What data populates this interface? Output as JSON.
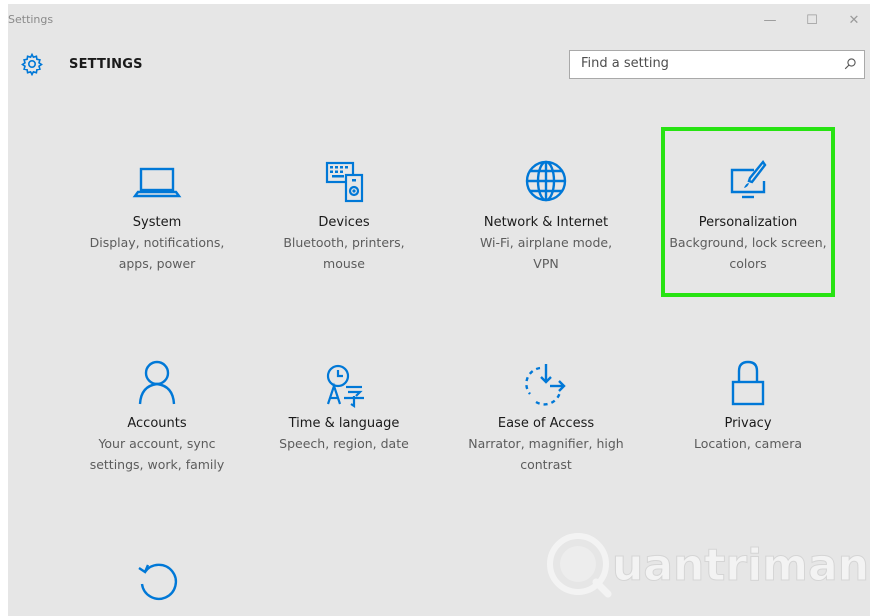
{
  "window": {
    "title": "Settings",
    "controls": {
      "minimize": "—",
      "maximize": "☐",
      "close": "✕"
    }
  },
  "header": {
    "title": "SETTINGS",
    "search_placeholder": "Find a setting"
  },
  "tiles": [
    {
      "label": "System",
      "desc": "Display, notifications, apps, power",
      "icon": "laptop-icon"
    },
    {
      "label": "Devices",
      "desc": "Bluetooth, printers, mouse",
      "icon": "devices-icon"
    },
    {
      "label": "Network & Internet",
      "desc": "Wi-Fi, airplane mode, VPN",
      "icon": "globe-icon"
    },
    {
      "label": "Personalization",
      "desc": "Background, lock screen, colors",
      "icon": "personalization-icon"
    },
    {
      "label": "Accounts",
      "desc": "Your account, sync settings, work, family",
      "icon": "person-icon"
    },
    {
      "label": "Time & language",
      "desc": "Speech, region, date",
      "icon": "time-language-icon"
    },
    {
      "label": "Ease of Access",
      "desc": "Narrator, magnifier, high contrast",
      "icon": "ease-of-access-icon"
    },
    {
      "label": "Privacy",
      "desc": "Location, camera",
      "icon": "lock-icon"
    },
    {
      "label": "",
      "desc": "",
      "icon": "update-recovery-icon"
    }
  ],
  "watermark": {
    "text": "uantrimang"
  },
  "colors": {
    "accent": "#0078d7",
    "highlight": "#27e312",
    "background": "#e6e6e6"
  }
}
